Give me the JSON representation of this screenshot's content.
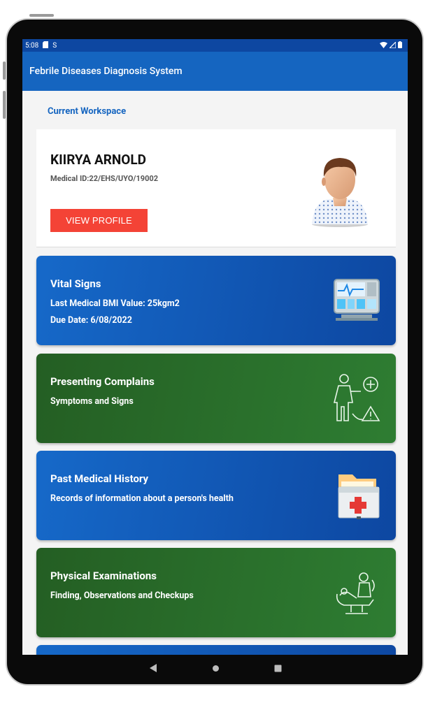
{
  "status_bar": {
    "time": "5:08"
  },
  "app_bar": {
    "title": "Febrile Diseases Diagnosis System"
  },
  "workspace": {
    "label": "Current Workspace"
  },
  "profile": {
    "name": "KIIRYA ARNOLD",
    "medical_id": "Medical ID:22/EHS/UYO/19002",
    "button_label": "VIEW PROFILE"
  },
  "cards": [
    {
      "title": "Vital Signs",
      "line1": "Last Medical BMI Value: 25kgm2",
      "line2": "Due Date: 6/08/2022",
      "color": "#1565c0",
      "icon": "monitor-icon"
    },
    {
      "title": "Presenting Complains",
      "line1": "Symptoms and Signs",
      "color": "#2e7d32",
      "icon": "symptoms-icon"
    },
    {
      "title": "Past Medical History",
      "line1": "Records of information about a person's health",
      "color": "#1565c0",
      "icon": "medical-folder-icon"
    },
    {
      "title": "Physical Examinations",
      "line1": "Finding, Observations and Checkups",
      "color": "#2e7d32",
      "icon": "examination-icon"
    }
  ],
  "colors": {
    "primary": "#1565c0",
    "status_bar": "#0d47a1",
    "accent_red": "#f44336",
    "green": "#2e7d32"
  }
}
